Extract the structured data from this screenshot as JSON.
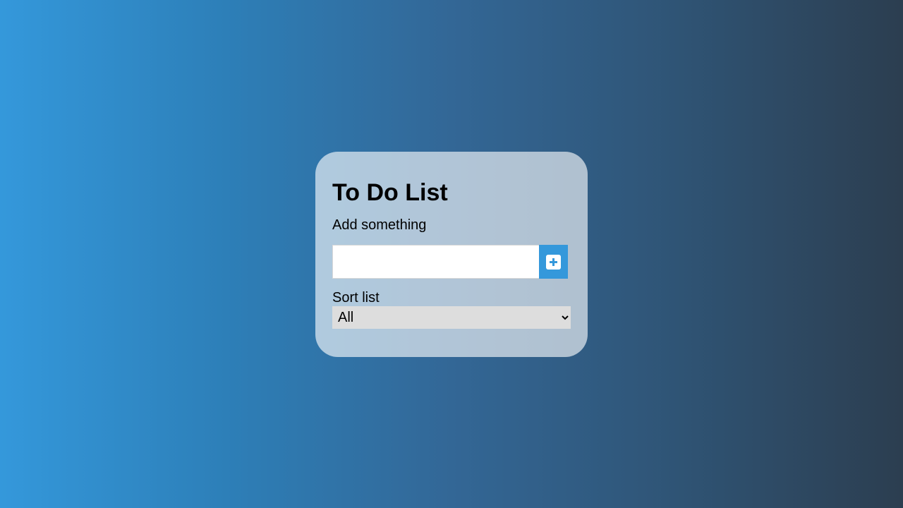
{
  "app": {
    "title": "To Do List",
    "subtitle": "Add something"
  },
  "input": {
    "value": "",
    "placeholder": ""
  },
  "add_button": {
    "icon": "plus-square-icon"
  },
  "sort": {
    "label": "Sort list",
    "selected": "All"
  },
  "colors": {
    "accent": "#3498db",
    "gradient_start": "#3498db",
    "gradient_end": "#2c3e50"
  }
}
